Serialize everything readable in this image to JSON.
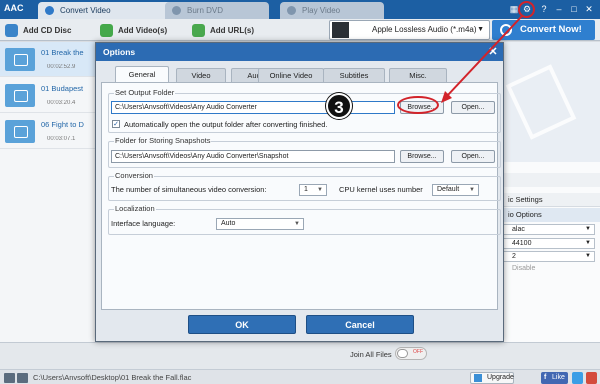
{
  "app": {
    "logo": "AAC",
    "tabs": [
      {
        "label": "Convert Video"
      },
      {
        "label": "Burn DVD"
      },
      {
        "label": "Play Video"
      }
    ],
    "window_controls": {
      "help": "?",
      "minimize": "–",
      "close": "✕"
    }
  },
  "toolbar": {
    "add_cd": "Add CD Disc",
    "add_video": "Add Video(s)",
    "add_url": "Add URL(s)",
    "format": "Apple Lossless Audio (*.m4a)",
    "convert": "Convert Now!"
  },
  "files": [
    {
      "name": "01 Break the",
      "duration": "00:02:52.9"
    },
    {
      "name": "01 Budapest",
      "duration": "00:03:20.4"
    },
    {
      "name": "06 Fight to D",
      "duration": "00:03:07.1"
    }
  ],
  "right_pane": {
    "basic_settings": "ic Settings",
    "audio_options": "io Options",
    "codec": "alac",
    "sample_rate": "44100",
    "channels": "2",
    "disable": "Disable"
  },
  "dialog": {
    "title": "Options",
    "close": "✕",
    "tabs": [
      "General",
      "Video",
      "Audio",
      "Online Video",
      "Subtitles",
      "Misc."
    ],
    "output_folder": {
      "legend": "Set Output Folder",
      "path": "C:\\Users\\Anvsoft\\Videos\\Any Audio Converter",
      "browse": "Browse...",
      "open": "Open...",
      "auto_open_label": "Automatically open the output folder after converting finished.",
      "auto_open_checked": "✓"
    },
    "snapshot_folder": {
      "legend": "Folder for Storing Snapshots",
      "path": "C:\\Users\\Anvsoft\\Videos\\Any Audio Converter\\Snapshot",
      "browse": "Browse...",
      "open": "Open..."
    },
    "conversion": {
      "legend": "Conversion",
      "simultaneous_label": "The number of simultaneous video conversion:",
      "simultaneous_value": "1",
      "kernel_label": "CPU kernel uses number",
      "kernel_value": "Default"
    },
    "localization": {
      "legend": "Localization",
      "language_label": "Interface language:",
      "language_value": "Auto"
    },
    "ok": "OK",
    "cancel": "Cancel"
  },
  "annotation": {
    "step": "3"
  },
  "status": {
    "join_all": "Join All Files",
    "toggle": "OFF",
    "path": "C:\\Users\\Anvsoft\\Desktop\\01 Break the Fall.flac",
    "upgrade": "Upgrade",
    "like": "Like"
  },
  "colors": {
    "title_bar": "#1c5fa3",
    "accent": "#2f7fcf",
    "annotation_red": "#d2232a"
  }
}
